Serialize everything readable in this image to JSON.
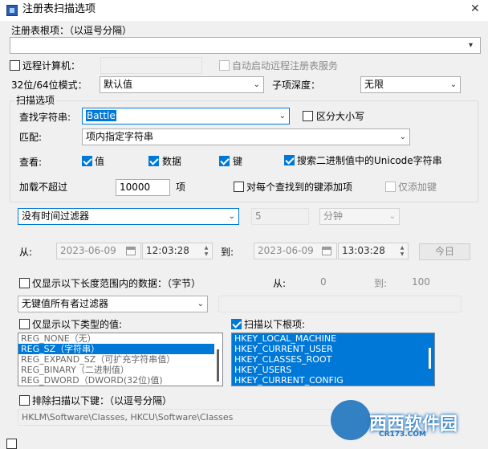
{
  "window": {
    "title": "注册表扫描选项"
  },
  "root_keys": {
    "label": "注册表根项：（以逗号分隔）",
    "value": ""
  },
  "remote": {
    "checkbox_label": "远程计算机：",
    "checked": false,
    "computer_value": "",
    "auto_start_label": "自动启动远程注册表服务",
    "auto_start_checked": false
  },
  "mode": {
    "label": "32位/64位模式：",
    "value": "默认值"
  },
  "depth": {
    "label": "子项深度：",
    "value": "无限"
  },
  "scan_group": {
    "title": "扫描选项",
    "find_label": "查找字符串:",
    "find_value": "Battle",
    "case_label": "区分大小写",
    "case_checked": false,
    "match_label": "匹配:",
    "match_value": "项内指定字符串",
    "look_label": "查看:",
    "look_value_label": "值",
    "look_data_label": "数据",
    "look_key_label": "键",
    "binary_unicode_label": "搜索二进制值中的Unicode字符串",
    "limit_label": "加载不超过",
    "limit_value": "10000",
    "limit_unit": "项",
    "add_key_label": "对每个查找到的键添加项",
    "add_key_only_label": "仅添加键"
  },
  "time_filter": {
    "value": "没有时间过滤器",
    "amount": "5",
    "unit": "分钟"
  },
  "date_range": {
    "from_label": "从:",
    "from_date": "2023-06-09",
    "from_time": "12:03:28",
    "to_label": "到:",
    "to_date": "2023-06-09",
    "to_time": "13:03:28",
    "today_label": "今日"
  },
  "length_filter": {
    "label": "仅显示以下长度范围内的数据：（字节）",
    "from_label": "从:",
    "from_value": "0",
    "to_label": "到:",
    "to_value": "100"
  },
  "owner_filter": {
    "value": "无键值所有者过滤器",
    "text": ""
  },
  "types": {
    "label": "仅显示以下类型的值:",
    "items": [
      "REG_NONE（无）",
      "REG_SZ（字符串）",
      "REG_EXPAND_SZ（可扩充字符串值）",
      "REG_BINARY（二进制值）",
      "REG_DWORD（DWORD(32位)值)"
    ]
  },
  "scan_roots": {
    "label": "扫描以下根项:",
    "items": [
      "HKEY_LOCAL_MACHINE",
      "HKEY_CURRENT_USER",
      "HKEY_CLASSES_ROOT",
      "HKEY_USERS",
      "HKEY_CURRENT_CONFIG"
    ]
  },
  "exclude": {
    "label": "排除扫描以下键：（以逗号分隔）",
    "value": "HKLM\\Software\\Classes, HKCU\\Software\\Classes"
  },
  "watermark": {
    "text": "西西软件园",
    "url": "CR173.COM"
  },
  "colors": {
    "accent": "#0078d7",
    "background": "#f0f0f0"
  }
}
